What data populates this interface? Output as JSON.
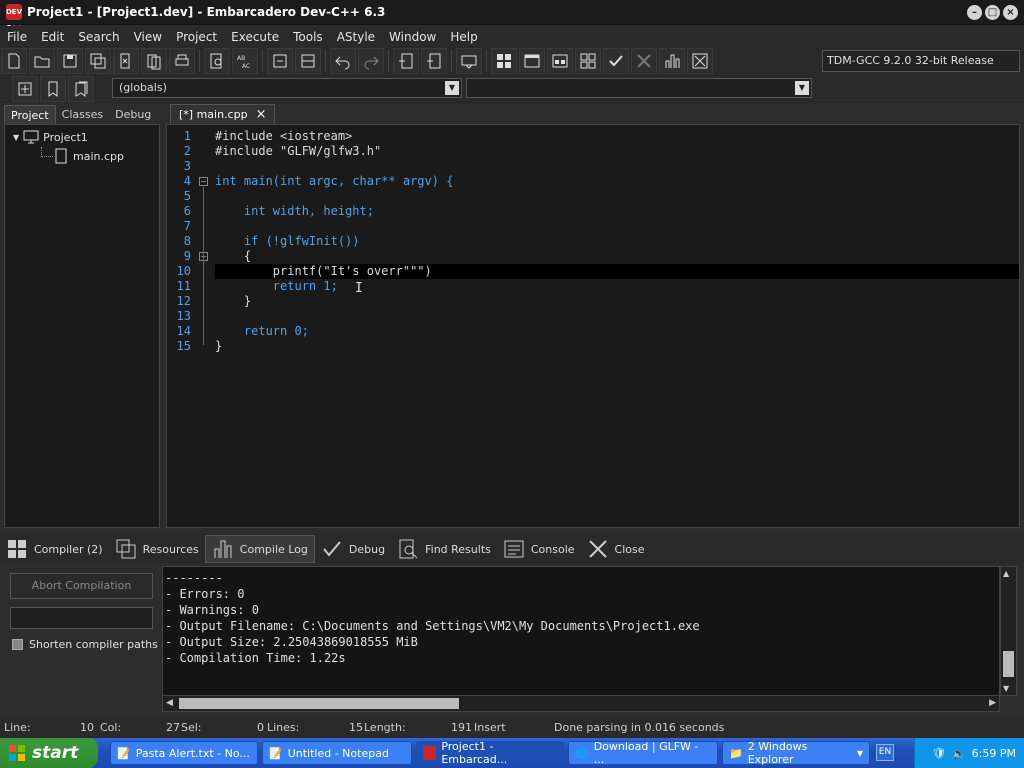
{
  "window": {
    "title": "Project1 - [Project1.dev] - Embarcadero Dev-C++ 6.3",
    "app_icon_text": "DEV C++"
  },
  "menu": [
    "File",
    "Edit",
    "Search",
    "View",
    "Project",
    "Execute",
    "Tools",
    "AStyle",
    "Window",
    "Help"
  ],
  "toolbar": {
    "compiler": "TDM-GCC 9.2.0 32-bit Release",
    "scope": "(globals)"
  },
  "left_panel": {
    "tabs": [
      "Project",
      "Classes",
      "Debug"
    ],
    "project_name": "Project1",
    "file_name": "main.cpp"
  },
  "editor": {
    "tab_label": "[*] main.cpp",
    "line_numbers": [
      "1",
      "2",
      "3",
      "4",
      "5",
      "6",
      "7",
      "8",
      "9",
      "10",
      "11",
      "12",
      "13",
      "14",
      "15"
    ],
    "lines": [
      "#include <iostream>",
      "#include \"GLFW/glfw3.h\"",
      "",
      "int main(int argc, char** argv) {",
      "",
      "    int width, height;",
      "",
      "    if (!glfwInit())",
      "    {",
      "        printf(\"It's overr\"\"\")",
      "        return 1;",
      "    }",
      "",
      "    return 0;",
      "}"
    ]
  },
  "bottom_tabs": [
    "Compiler (2)",
    "Resources",
    "Compile Log",
    "Debug",
    "Find Results",
    "Console",
    "Close"
  ],
  "compile": {
    "abort_label": "Abort Compilation",
    "shorten_label": "Shorten compiler paths",
    "log": [
      "--------",
      "- Errors: 0",
      "- Warnings: 0",
      "- Output Filename: C:\\Documents and Settings\\VM2\\My Documents\\Project1.exe",
      "- Output Size: 2.25043869018555 MiB",
      "- Compilation Time: 1.22s"
    ]
  },
  "status": {
    "line_label": "Line:",
    "line_value": "10",
    "col_label": "Col:",
    "col_value": "27",
    "sel_label": "Sel:",
    "sel_value": "0",
    "lines_label": "Lines:",
    "lines_value": "15",
    "length_label": "Length:",
    "length_value": "191",
    "mode": "Insert",
    "message": "Done parsing in 0.016 seconds"
  },
  "taskbar": {
    "start": "start",
    "tasks": [
      "Pasta Alert.txt - No...",
      "Untitled - Notepad",
      "Project1 - Embarcad...",
      "Download | GLFW - ...",
      "2 Windows Explorer"
    ],
    "lang": "EN",
    "time": "6:59 PM"
  }
}
